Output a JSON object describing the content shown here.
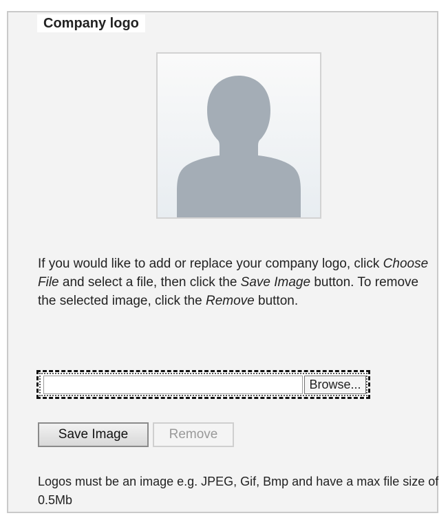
{
  "fieldset": {
    "legend": "Company logo"
  },
  "avatar": {
    "icon": "person-silhouette-icon",
    "color": "#a4adb6"
  },
  "instructions": {
    "part1": "If you would like to add or replace your company logo, click ",
    "choose_file": "Choose File",
    "part2": " and select a file, then click the ",
    "save_image": "Save Image",
    "part3": " button. To remove the selected image, click the ",
    "remove": "Remove",
    "part4": " button."
  },
  "file_input": {
    "value": "",
    "browse_label": "Browse..."
  },
  "buttons": {
    "save_label": "Save Image",
    "remove_label": "Remove",
    "remove_disabled": true
  },
  "note": "Logos must be an image e.g. JPEG, Gif, Bmp and have a max file size of 0.5Mb"
}
